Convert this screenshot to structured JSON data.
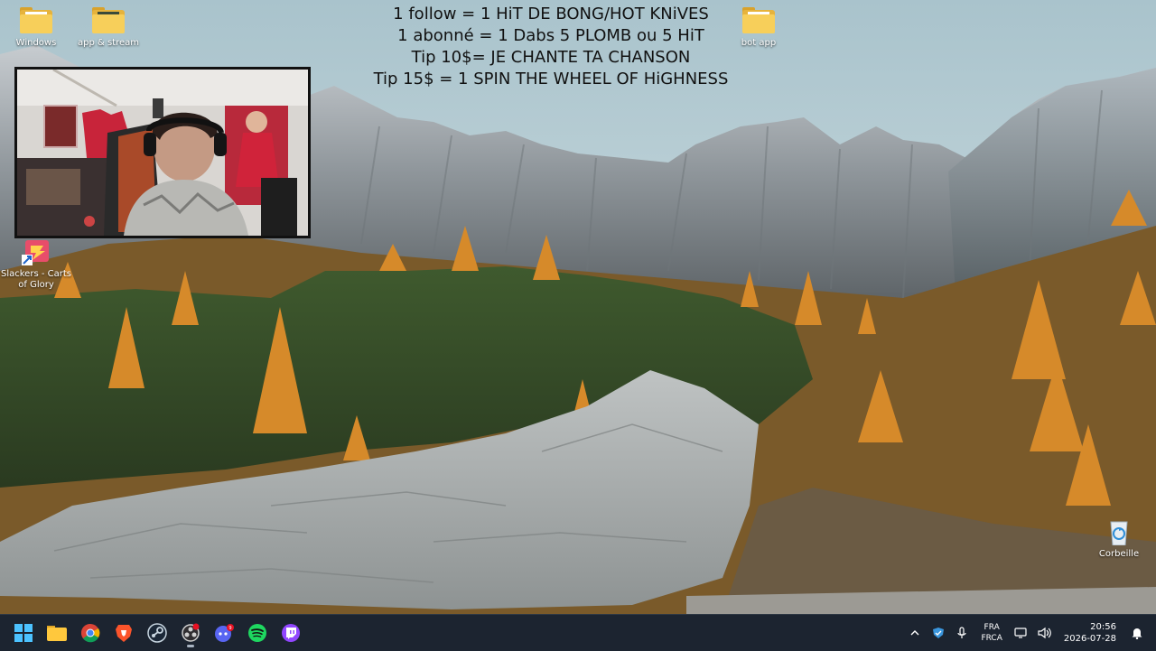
{
  "overlay": {
    "lines": [
      "1 follow = 1 HiT DE BONG/HOT KNiVES",
      "1 abonné = 1 Dabs  5 PLOMB ou 5 HiT",
      "Tip 10$= JE CHANTE TA CHANSON",
      "Tip 15$ = 1 SPIN THE WHEEL OF HiGHNESS"
    ]
  },
  "desktop": {
    "icons": [
      {
        "label": "Windows",
        "icon": "folder-icon"
      },
      {
        "label": "app & stream",
        "icon": "folder-icon"
      },
      {
        "label": "bot app",
        "icon": "folder-icon"
      },
      {
        "label": "Slackers - Carts of Glory",
        "icon": "game-shortcut-icon"
      },
      {
        "label": "Corbeille",
        "icon": "recycle-bin-icon"
      }
    ]
  },
  "taskbar": {
    "apps": [
      {
        "name": "Démarrer",
        "icon": "windows-start-icon"
      },
      {
        "name": "Explorateur de fichiers",
        "icon": "file-explorer-icon"
      },
      {
        "name": "Chrome",
        "icon": "chrome-icon"
      },
      {
        "name": "Brave",
        "icon": "brave-icon"
      },
      {
        "name": "Steam",
        "icon": "steam-icon"
      },
      {
        "name": "OBS Studio",
        "icon": "obs-icon"
      },
      {
        "name": "Discord",
        "icon": "discord-icon"
      },
      {
        "name": "Spotify",
        "icon": "spotify-icon"
      },
      {
        "name": "Twitch",
        "icon": "twitch-icon"
      }
    ],
    "tray": {
      "lang_line1": "FRA",
      "lang_line2": "FRCA",
      "time": "20:56",
      "date": "2026-07-28"
    }
  },
  "colors": {
    "taskbar_bg": "#1c2430",
    "folder_yellow": "#f7cf5a",
    "overlay_text": "#111111"
  }
}
